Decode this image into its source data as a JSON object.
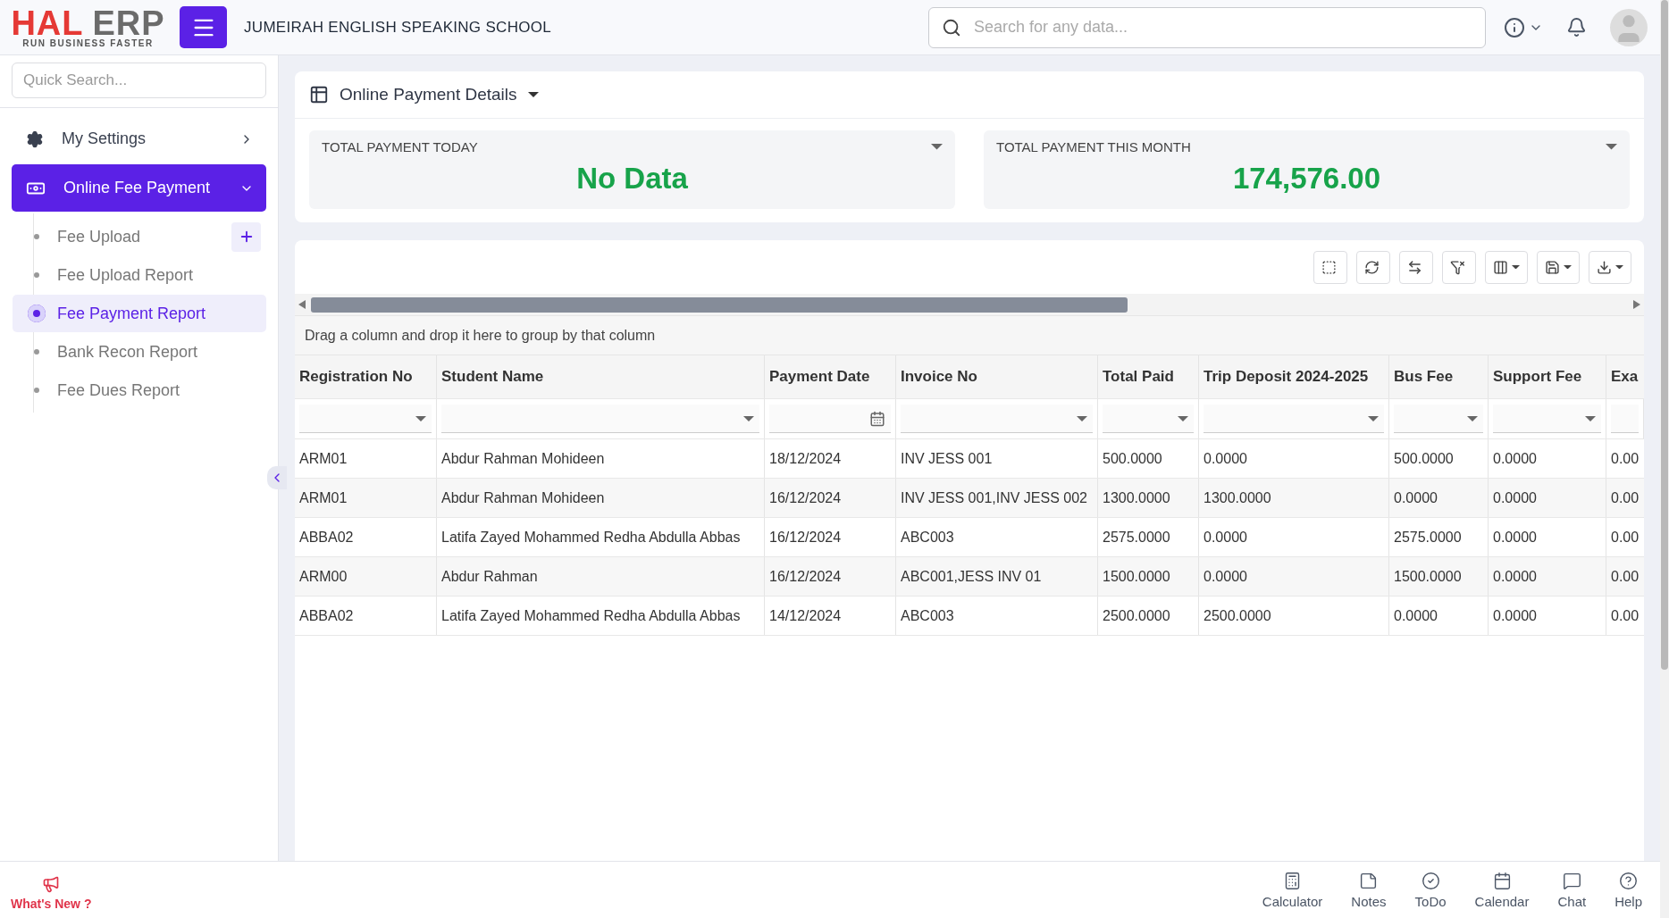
{
  "header": {
    "logo": {
      "part_1": "HAL",
      "part_2": "ERP",
      "tagline": "RUN BUSINESS FASTER"
    },
    "school_name": "JUMEIRAH ENGLISH SPEAKING SCHOOL",
    "search": {
      "placeholder": "Search for any data..."
    }
  },
  "sidebar": {
    "quick_search": {
      "placeholder": "Quick Search..."
    },
    "menu": [
      {
        "label": "My Settings",
        "kind": "settings",
        "selected": false,
        "expanded": false
      },
      {
        "label": "Online Fee Payment",
        "kind": "payment",
        "selected": true,
        "expanded": true,
        "children": [
          {
            "label": "Fee Upload",
            "selected": false,
            "add_button": true
          },
          {
            "label": "Fee Upload Report",
            "selected": false,
            "add_button": false
          },
          {
            "label": "Fee Payment Report",
            "selected": true,
            "add_button": false
          },
          {
            "label": "Bank Recon Report",
            "selected": false,
            "add_button": false
          },
          {
            "label": "Fee Dues Report",
            "selected": false,
            "add_button": false
          }
        ]
      }
    ]
  },
  "panel": {
    "title": "Online Payment Details",
    "stats": [
      {
        "label": "TOTAL PAYMENT TODAY",
        "value": "No Data"
      },
      {
        "label": "TOTAL PAYMENT THIS MONTH",
        "value": "174,576.00"
      }
    ]
  },
  "grid": {
    "group_hint": "Drag a column and drop it here to group by that column",
    "columns": [
      {
        "label": "Registration No",
        "kind": "dropdown"
      },
      {
        "label": "Student Name",
        "kind": "dropdown"
      },
      {
        "label": "Payment Date",
        "kind": "date"
      },
      {
        "label": "Invoice No",
        "kind": "dropdown"
      },
      {
        "label": "Total Paid",
        "kind": "dropdown"
      },
      {
        "label": "Trip Deposit 2024-2025",
        "kind": "dropdown"
      },
      {
        "label": "Bus Fee",
        "kind": "dropdown"
      },
      {
        "label": "Support Fee",
        "kind": "dropdown"
      },
      {
        "label": "Exa",
        "kind": "blank"
      }
    ],
    "rows": [
      [
        "ARM01",
        "Abdur Rahman Mohideen",
        "18/12/2024",
        "INV JESS 001",
        "500.0000",
        "0.0000",
        "500.0000",
        "0.0000",
        "0.00"
      ],
      [
        "ARM01",
        "Abdur Rahman Mohideen",
        "16/12/2024",
        "INV JESS 001,INV JESS 002",
        "1300.0000",
        "1300.0000",
        "0.0000",
        "0.0000",
        "0.00"
      ],
      [
        "ABBA02",
        "Latifa Zayed Mohammed Redha Abdulla Abbas",
        "16/12/2024",
        "ABC003",
        "2575.0000",
        "0.0000",
        "2575.0000",
        "0.0000",
        "0.00"
      ],
      [
        "ARM00",
        "Abdur Rahman",
        "16/12/2024",
        "ABC001,JESS INV 01",
        "1500.0000",
        "0.0000",
        "1500.0000",
        "0.0000",
        "0.00"
      ],
      [
        "ABBA02",
        "Latifa Zayed Mohammed Redha Abdulla Abbas",
        "14/12/2024",
        "ABC003",
        "2500.0000",
        "2500.0000",
        "0.0000",
        "0.0000",
        "0.00"
      ]
    ]
  },
  "footer": {
    "whats_new": "What's New ?",
    "tools": [
      "Calculator",
      "Notes",
      "ToDo",
      "Calendar",
      "Chat",
      "Help"
    ]
  }
}
